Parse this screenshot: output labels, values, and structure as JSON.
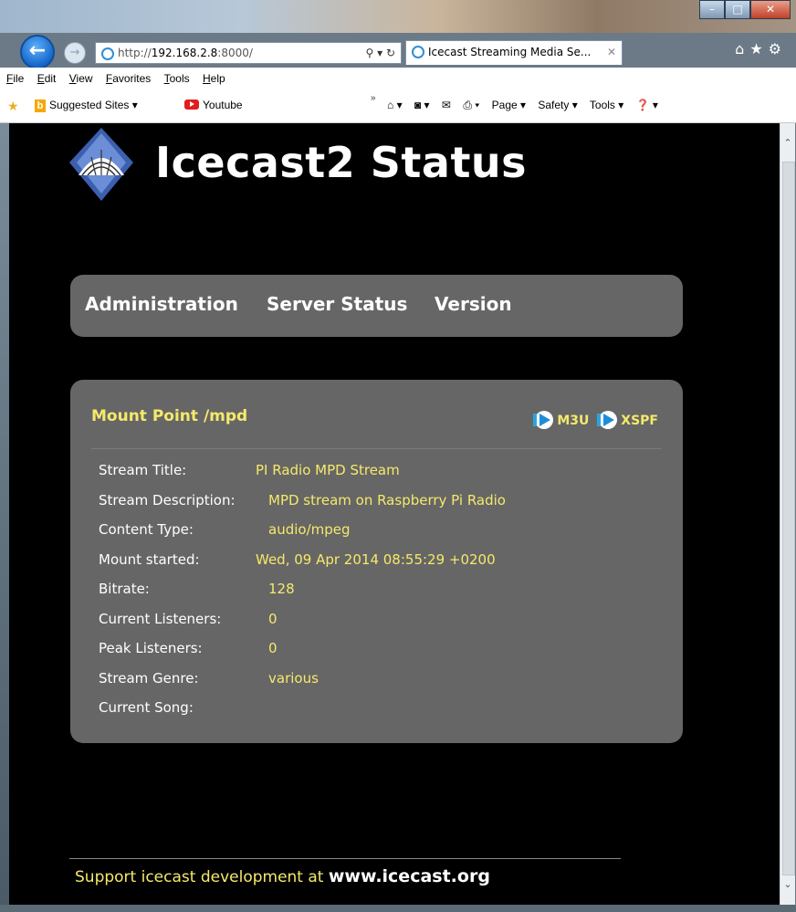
{
  "browser": {
    "address": "http://192.168.2.8:8000/",
    "address_host": "192.168.2.8",
    "address_prefix": "http://",
    "address_suffix": ":8000/",
    "tab_title": "Icecast Streaming Media Se...",
    "menu": [
      "File",
      "Edit",
      "View",
      "Favorites",
      "Tools",
      "Help"
    ],
    "favorites": {
      "suggested": "Suggested Sites ▾",
      "youtube": "Youtube"
    },
    "commands": {
      "page": "Page ▾",
      "safety": "Safety ▾",
      "tools": "Tools ▾"
    }
  },
  "page": {
    "title": "Icecast2 Status",
    "nav": [
      "Administration",
      "Server Status",
      "Version"
    ],
    "mount": {
      "title": "Mount Point /mpd",
      "links": [
        "M3U",
        "XSPF"
      ],
      "rows": [
        {
          "label": "Stream Title:",
          "value": "PI Radio MPD Stream"
        },
        {
          "label": "Stream Description:",
          "value": "MPD stream on Raspberry Pi Radio"
        },
        {
          "label": "Content Type:",
          "value": "audio/mpeg"
        },
        {
          "label": "Mount started:",
          "value": "Wed, 09 Apr 2014 08:55:29 +0200"
        },
        {
          "label": "Bitrate:",
          "value": "128"
        },
        {
          "label": "Current Listeners:",
          "value": "0"
        },
        {
          "label": "Peak Listeners:",
          "value": "0"
        },
        {
          "label": "Stream Genre:",
          "value": "various"
        },
        {
          "label": "Current Song:",
          "value": ""
        }
      ]
    },
    "footer": {
      "text": "Support icecast development at ",
      "link": "www.icecast.org"
    }
  }
}
